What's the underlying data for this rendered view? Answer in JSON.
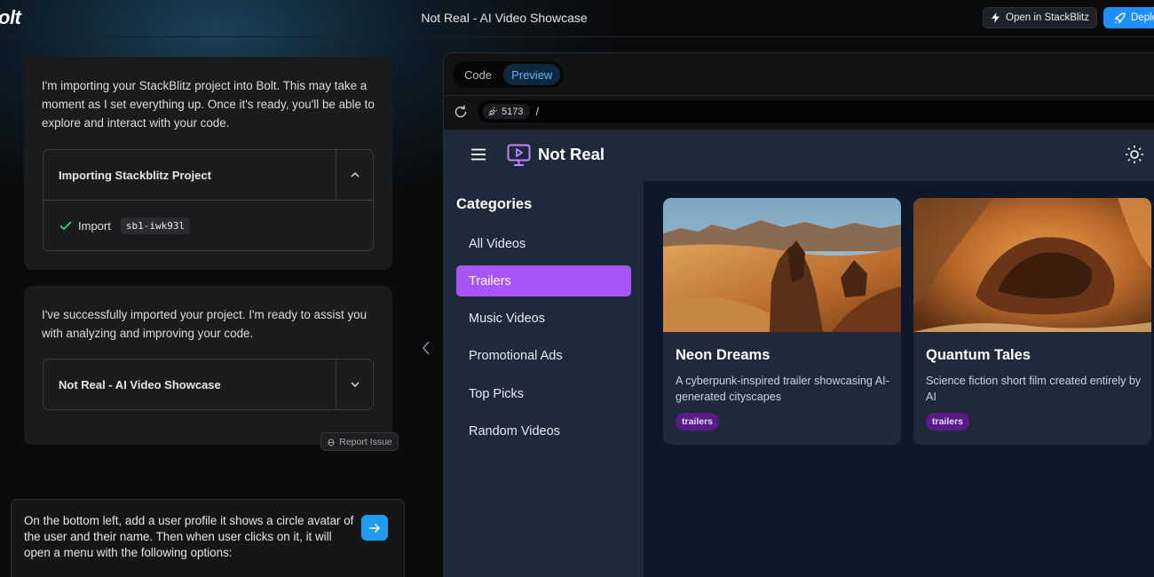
{
  "topbar": {
    "logo": "olt",
    "title": "Not Real - AI Video Showcase",
    "open_label": "Open in StackBlitz",
    "deploy_label": "Deplo"
  },
  "chat": {
    "message1": "I'm importing your StackBlitz project into Bolt. This may take a moment as I set everything up. Once it's ready, you'll be able to explore and interact with your code.",
    "artifact1": {
      "title": "Importing Stackblitz Project",
      "step_label": "Import",
      "step_code": "sb1-iwk93l"
    },
    "message2": "I've successfully imported your project. I'm ready to assist you with analyzing and improving your code.",
    "artifact2": {
      "title": "Not Real - AI Video Showcase"
    },
    "report_label": "Report Issue",
    "input_text": "On the bottom left, add a user profile it shows a circle avatar of the user and their name. Then when user clicks on it, it will open a menu with the following options:"
  },
  "workbench": {
    "tabs": [
      {
        "label": "Code",
        "active": false
      },
      {
        "label": "Preview",
        "active": true
      }
    ],
    "port": "5173",
    "path": "/"
  },
  "preview": {
    "app_name": "Not Real",
    "categories_title": "Categories",
    "categories": [
      {
        "label": "All Videos",
        "active": false
      },
      {
        "label": "Trailers",
        "active": true
      },
      {
        "label": "Music Videos",
        "active": false
      },
      {
        "label": "Promotional Ads",
        "active": false
      },
      {
        "label": "Top Picks",
        "active": false
      },
      {
        "label": "Random Videos",
        "active": false
      }
    ],
    "videos": [
      {
        "title": "Neon Dreams",
        "description": "A cyberpunk-inspired trailer showcasing AI-generated cityscapes",
        "tag": "trailers"
      },
      {
        "title": "Quantum Tales",
        "description": "Science fiction short film created entirely by AI",
        "tag": "trailers"
      }
    ]
  },
  "colors": {
    "accent_blue": "#1f8fff",
    "preview_tab_text": "#62b6f6",
    "category_active": "#a855f7",
    "tag_bg": "#581c87",
    "app_bg": "#0f172a",
    "panel_bg": "#1e293b"
  },
  "icons": {
    "open": "bolt-icon",
    "deploy": "rocket-icon",
    "check": "check-icon",
    "send": "arrow-right-icon",
    "reload": "reload-icon",
    "port": "plug-icon",
    "menu": "hamburger-icon",
    "app_logo": "play-screen-icon",
    "theme": "sun-icon"
  }
}
